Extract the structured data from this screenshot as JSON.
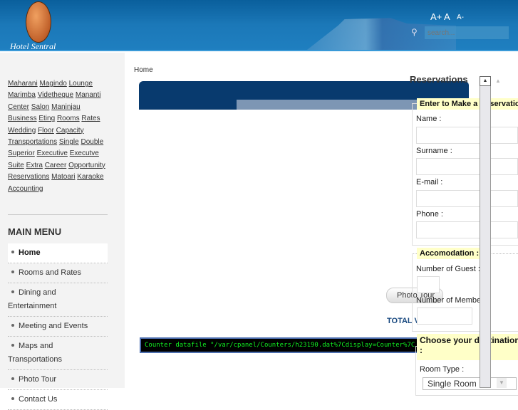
{
  "header": {
    "logo_text": "Hotel Sentral",
    "font_increase": "A+",
    "font_normal": "A",
    "font_decrease": "A-",
    "search_placeholder": "search..."
  },
  "tags": [
    "Maharani",
    "Magindo",
    "Lounge",
    "Marimba",
    "Videtheque",
    "Mananti",
    "Center",
    "Salon",
    "Maninjau",
    "Business",
    "Eting",
    "Rooms",
    "Rates",
    "Wedding",
    "Floor",
    "Capacity",
    "Transportations",
    "Single",
    "Double",
    "Superior",
    "Executive",
    "Executve",
    "Suite",
    "Extra",
    "Career",
    "Opportunity",
    "Reservations",
    "Matoari",
    "Karaoke",
    "Accounting"
  ],
  "menu": {
    "title": "MAIN MENU",
    "items": [
      {
        "label": "Home",
        "active": true
      },
      {
        "label": "Rooms and Rates"
      },
      {
        "label": "Dining and",
        "cont": "Entertainment"
      },
      {
        "label": "Meeting and Events"
      },
      {
        "label": "Maps and",
        "cont": "Transportations"
      },
      {
        "label": "Photo Tour"
      },
      {
        "label": "Contact Us"
      }
    ]
  },
  "breadcrumb": "Home",
  "main": {
    "photo_tour": "Photo Tour",
    "total": "TOTAL V",
    "counter": "Counter datafile \"/var/cpanel/Counters/h23190.dat%7Cdisplay=Counter%7C"
  },
  "reservations": {
    "title": "Reservations",
    "legend1": "Enter to Make a Reservation",
    "name": "Name :",
    "surname": "Surname :",
    "email": "E-mail :",
    "phone": "Phone :",
    "legend2": "Accomodation :",
    "guests": "Number of Guest :",
    "members": "Number of Member:",
    "legend3": "Choose your destination",
    "legend3b": ":",
    "room_type": "Room Type :",
    "room_value": "Single Room"
  },
  "colors": {
    "header": "#1b78b8",
    "banner": "#083a6e",
    "legend_bg": "#ffffc8",
    "counter_text": "#11ee22"
  }
}
